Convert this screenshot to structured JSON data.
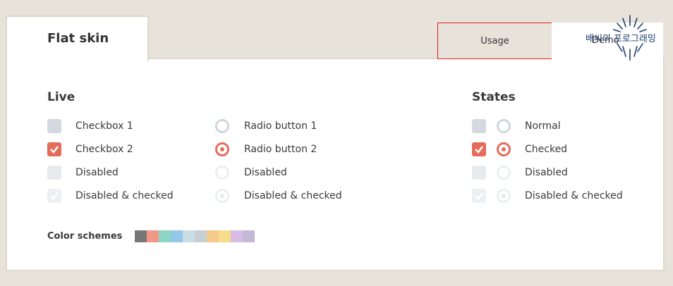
{
  "tabs": {
    "active": "Flat skin",
    "usage": "Usage",
    "demo": "Demo"
  },
  "watermark": {
    "text": "배씨의 프로그래밍"
  },
  "live": {
    "title": "Live",
    "checkboxes": [
      {
        "label": "Checkbox 1",
        "state": "normal"
      },
      {
        "label": "Checkbox 2",
        "state": "checked"
      },
      {
        "label": "Disabled",
        "state": "disabled"
      },
      {
        "label": "Disabled & checked",
        "state": "disabled-checked"
      }
    ],
    "radios": [
      {
        "label": "Radio button 1",
        "state": "normal"
      },
      {
        "label": "Radio button 2",
        "state": "checked"
      },
      {
        "label": "Disabled",
        "state": "disabled"
      },
      {
        "label": "Disabled & checked",
        "state": "disabled-checked"
      }
    ]
  },
  "states": {
    "title": "States",
    "rows": [
      {
        "label": "Normal",
        "state": "normal"
      },
      {
        "label": "Checked",
        "state": "checked"
      },
      {
        "label": "Disabled",
        "state": "disabled"
      },
      {
        "label": "Disabled & checked",
        "state": "disabled-checked"
      }
    ]
  },
  "color_schemes": {
    "label": "Color schemes",
    "swatches": [
      "#777777",
      "#f29686",
      "#8ed6c4",
      "#94c8ea",
      "#c8dde4",
      "#c6cfd3",
      "#f5c98a",
      "#f7dc8a",
      "#d7bde6",
      "#c3b8d6"
    ]
  }
}
